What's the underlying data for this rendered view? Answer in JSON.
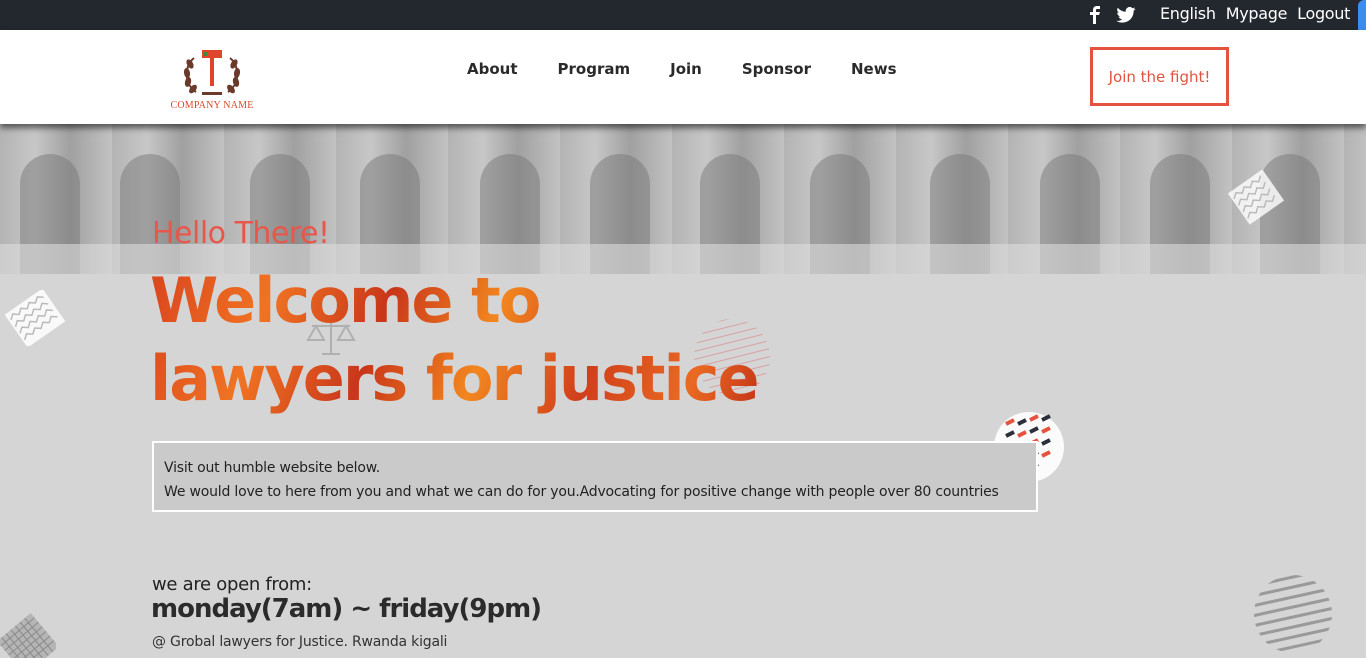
{
  "topbar": {
    "icons": [
      "facebook-icon",
      "twitter-icon"
    ],
    "links": [
      "English",
      "Mypage",
      "Logout"
    ]
  },
  "header": {
    "logo_text": "COMPANY NAME",
    "nav": [
      "About",
      "Program",
      "Join",
      "Sponsor",
      "News"
    ],
    "cta": "Join the fight!"
  },
  "hero": {
    "greeting": "Hello There!",
    "title_line1": "Welcome to",
    "title_line2": "lawyers for justice",
    "info_line1": "Visit out humble website below.",
    "info_line2": "We would love to here from you and what we can do for you.Advocating for positive change with people over 80 countries",
    "open_label": "we are open from:",
    "hours": "monday(7am) ~ friday(9pm)",
    "address": "@ Grobal lawyers for Justice. Rwanda kigali"
  },
  "colors": {
    "topbar_bg": "#23272e",
    "accent": "#e4533f",
    "hero_bg": "#d5d5d5",
    "title_gradient": [
      "#d9431e",
      "#f07322",
      "#c9361a"
    ]
  }
}
